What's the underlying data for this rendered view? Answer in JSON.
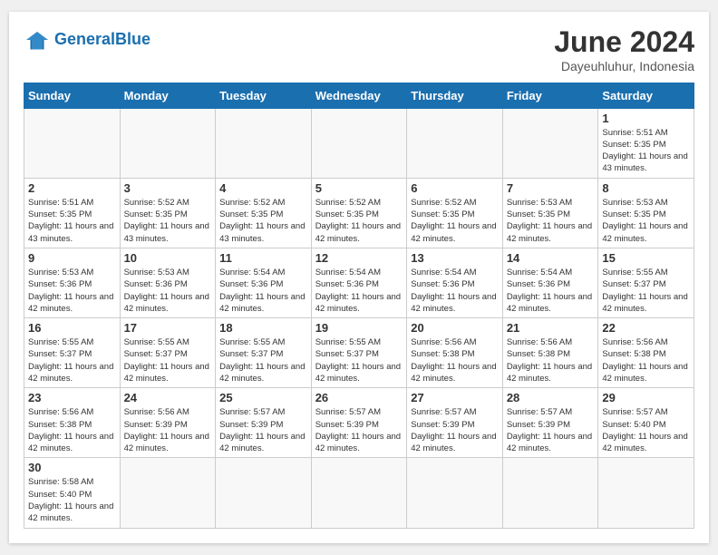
{
  "header": {
    "logo_general": "General",
    "logo_blue": "Blue",
    "month_title": "June 2024",
    "subtitle": "Dayeuhluhur, Indonesia"
  },
  "weekdays": [
    "Sunday",
    "Monday",
    "Tuesday",
    "Wednesday",
    "Thursday",
    "Friday",
    "Saturday"
  ],
  "days": [
    {
      "num": "",
      "empty": true,
      "sunrise": "",
      "sunset": "",
      "daylight": ""
    },
    {
      "num": "",
      "empty": true,
      "sunrise": "",
      "sunset": "",
      "daylight": ""
    },
    {
      "num": "",
      "empty": true,
      "sunrise": "",
      "sunset": "",
      "daylight": ""
    },
    {
      "num": "",
      "empty": true,
      "sunrise": "",
      "sunset": "",
      "daylight": ""
    },
    {
      "num": "",
      "empty": true,
      "sunrise": "",
      "sunset": "",
      "daylight": ""
    },
    {
      "num": "",
      "empty": true,
      "sunrise": "",
      "sunset": "",
      "daylight": ""
    },
    {
      "num": "1",
      "sunrise": "Sunrise: 5:51 AM",
      "sunset": "Sunset: 5:35 PM",
      "daylight": "Daylight: 11 hours and 43 minutes."
    },
    {
      "num": "2",
      "sunrise": "Sunrise: 5:51 AM",
      "sunset": "Sunset: 5:35 PM",
      "daylight": "Daylight: 11 hours and 43 minutes."
    },
    {
      "num": "3",
      "sunrise": "Sunrise: 5:52 AM",
      "sunset": "Sunset: 5:35 PM",
      "daylight": "Daylight: 11 hours and 43 minutes."
    },
    {
      "num": "4",
      "sunrise": "Sunrise: 5:52 AM",
      "sunset": "Sunset: 5:35 PM",
      "daylight": "Daylight: 11 hours and 43 minutes."
    },
    {
      "num": "5",
      "sunrise": "Sunrise: 5:52 AM",
      "sunset": "Sunset: 5:35 PM",
      "daylight": "Daylight: 11 hours and 42 minutes."
    },
    {
      "num": "6",
      "sunrise": "Sunrise: 5:52 AM",
      "sunset": "Sunset: 5:35 PM",
      "daylight": "Daylight: 11 hours and 42 minutes."
    },
    {
      "num": "7",
      "sunrise": "Sunrise: 5:53 AM",
      "sunset": "Sunset: 5:35 PM",
      "daylight": "Daylight: 11 hours and 42 minutes."
    },
    {
      "num": "8",
      "sunrise": "Sunrise: 5:53 AM",
      "sunset": "Sunset: 5:35 PM",
      "daylight": "Daylight: 11 hours and 42 minutes."
    },
    {
      "num": "9",
      "sunrise": "Sunrise: 5:53 AM",
      "sunset": "Sunset: 5:36 PM",
      "daylight": "Daylight: 11 hours and 42 minutes."
    },
    {
      "num": "10",
      "sunrise": "Sunrise: 5:53 AM",
      "sunset": "Sunset: 5:36 PM",
      "daylight": "Daylight: 11 hours and 42 minutes."
    },
    {
      "num": "11",
      "sunrise": "Sunrise: 5:54 AM",
      "sunset": "Sunset: 5:36 PM",
      "daylight": "Daylight: 11 hours and 42 minutes."
    },
    {
      "num": "12",
      "sunrise": "Sunrise: 5:54 AM",
      "sunset": "Sunset: 5:36 PM",
      "daylight": "Daylight: 11 hours and 42 minutes."
    },
    {
      "num": "13",
      "sunrise": "Sunrise: 5:54 AM",
      "sunset": "Sunset: 5:36 PM",
      "daylight": "Daylight: 11 hours and 42 minutes."
    },
    {
      "num": "14",
      "sunrise": "Sunrise: 5:54 AM",
      "sunset": "Sunset: 5:36 PM",
      "daylight": "Daylight: 11 hours and 42 minutes."
    },
    {
      "num": "15",
      "sunrise": "Sunrise: 5:55 AM",
      "sunset": "Sunset: 5:37 PM",
      "daylight": "Daylight: 11 hours and 42 minutes."
    },
    {
      "num": "16",
      "sunrise": "Sunrise: 5:55 AM",
      "sunset": "Sunset: 5:37 PM",
      "daylight": "Daylight: 11 hours and 42 minutes."
    },
    {
      "num": "17",
      "sunrise": "Sunrise: 5:55 AM",
      "sunset": "Sunset: 5:37 PM",
      "daylight": "Daylight: 11 hours and 42 minutes."
    },
    {
      "num": "18",
      "sunrise": "Sunrise: 5:55 AM",
      "sunset": "Sunset: 5:37 PM",
      "daylight": "Daylight: 11 hours and 42 minutes."
    },
    {
      "num": "19",
      "sunrise": "Sunrise: 5:55 AM",
      "sunset": "Sunset: 5:37 PM",
      "daylight": "Daylight: 11 hours and 42 minutes."
    },
    {
      "num": "20",
      "sunrise": "Sunrise: 5:56 AM",
      "sunset": "Sunset: 5:38 PM",
      "daylight": "Daylight: 11 hours and 42 minutes."
    },
    {
      "num": "21",
      "sunrise": "Sunrise: 5:56 AM",
      "sunset": "Sunset: 5:38 PM",
      "daylight": "Daylight: 11 hours and 42 minutes."
    },
    {
      "num": "22",
      "sunrise": "Sunrise: 5:56 AM",
      "sunset": "Sunset: 5:38 PM",
      "daylight": "Daylight: 11 hours and 42 minutes."
    },
    {
      "num": "23",
      "sunrise": "Sunrise: 5:56 AM",
      "sunset": "Sunset: 5:38 PM",
      "daylight": "Daylight: 11 hours and 42 minutes."
    },
    {
      "num": "24",
      "sunrise": "Sunrise: 5:56 AM",
      "sunset": "Sunset: 5:39 PM",
      "daylight": "Daylight: 11 hours and 42 minutes."
    },
    {
      "num": "25",
      "sunrise": "Sunrise: 5:57 AM",
      "sunset": "Sunset: 5:39 PM",
      "daylight": "Daylight: 11 hours and 42 minutes."
    },
    {
      "num": "26",
      "sunrise": "Sunrise: 5:57 AM",
      "sunset": "Sunset: 5:39 PM",
      "daylight": "Daylight: 11 hours and 42 minutes."
    },
    {
      "num": "27",
      "sunrise": "Sunrise: 5:57 AM",
      "sunset": "Sunset: 5:39 PM",
      "daylight": "Daylight: 11 hours and 42 minutes."
    },
    {
      "num": "28",
      "sunrise": "Sunrise: 5:57 AM",
      "sunset": "Sunset: 5:39 PM",
      "daylight": "Daylight: 11 hours and 42 minutes."
    },
    {
      "num": "29",
      "sunrise": "Sunrise: 5:57 AM",
      "sunset": "Sunset: 5:40 PM",
      "daylight": "Daylight: 11 hours and 42 minutes."
    },
    {
      "num": "30",
      "sunrise": "Sunrise: 5:58 AM",
      "sunset": "Sunset: 5:40 PM",
      "daylight": "Daylight: 11 hours and 42 minutes."
    }
  ]
}
